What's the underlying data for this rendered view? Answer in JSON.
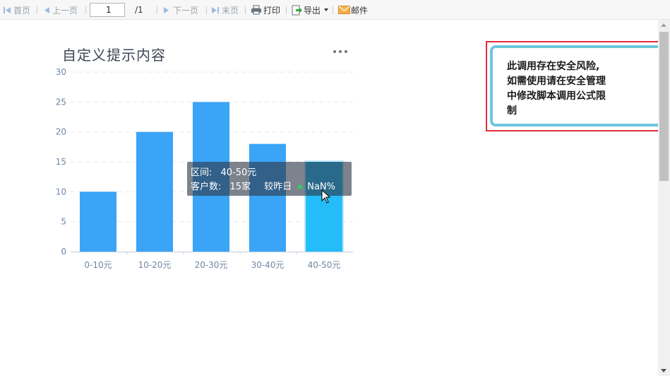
{
  "toolbar": {
    "first_page": "首页",
    "prev_page": "上一页",
    "current_page": "1",
    "total_pages": "/1",
    "next_page": "下一页",
    "last_page": "末页",
    "print": "打印",
    "export": "导出",
    "mail": "邮件"
  },
  "chart": {
    "title": "自定义提示内容"
  },
  "chart_data": {
    "type": "bar",
    "title": "自定义提示内容",
    "categories": [
      "0-10元",
      "10-20元",
      "20-30元",
      "30-40元",
      "40-50元"
    ],
    "values": [
      10,
      20,
      25,
      18,
      15
    ],
    "ylim": [
      0,
      30
    ],
    "yticks": [
      "0",
      "5",
      "10",
      "15",
      "20",
      "25",
      "30"
    ],
    "grid": "horizontal dashed",
    "bar_color": "#3aa4f6",
    "highlight_color": "#24bdfa",
    "highlighted_index": 4
  },
  "tooltip": {
    "interval_label": "区间:",
    "interval_value": "40-50元",
    "count_label": "客户数:",
    "count_value": "15家",
    "compare_label": "较昨日",
    "compare_value": "NaN%"
  },
  "warning": {
    "line1": "此调用存在安全风险,",
    "line2": "如需使用请在安全管理",
    "line3": "中修改脚本调用公式限",
    "line4": "制"
  },
  "colors": {
    "bar": "#3aa4f6",
    "bar_highlight": "#24bdfa",
    "warning_border": "#e32c3d",
    "warning_inner_border": "#6ec7dc",
    "tooltip_arrow": "#2fd05a"
  }
}
